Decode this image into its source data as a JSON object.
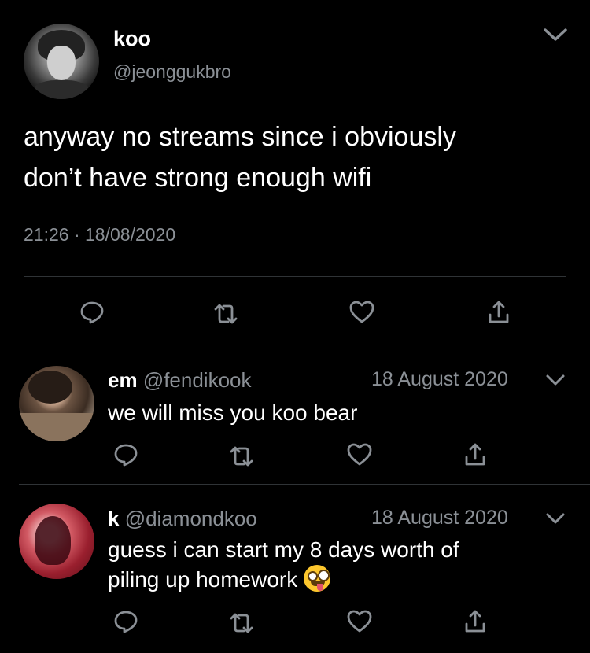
{
  "main_tweet": {
    "display_name": "koo",
    "handle": "@jeonggukbro",
    "text_line1": "anyway no streams since i obviously",
    "text_line2": "don’t have strong enough wifi",
    "time": "21:26",
    "separator": "·",
    "date": "18/08/2020"
  },
  "replies": [
    {
      "display_name": "em",
      "handle": "@fendikook",
      "date": "18 August 2020",
      "text": "we will miss you koo bear"
    },
    {
      "display_name": "k",
      "handle": "@diamondkoo",
      "date": "18 August 2020",
      "text_line1": "guess i can start my 8 days worth of",
      "text_line2": "piling up homework",
      "emoji": "zany-face-emoji"
    }
  ],
  "icons": [
    "chevron-down-icon",
    "reply-icon",
    "retweet-icon",
    "like-icon",
    "share-icon"
  ],
  "colors": {
    "background": "#000000",
    "text": "#ffffff",
    "secondary": "#8b9096",
    "divider": "#2f3336"
  }
}
